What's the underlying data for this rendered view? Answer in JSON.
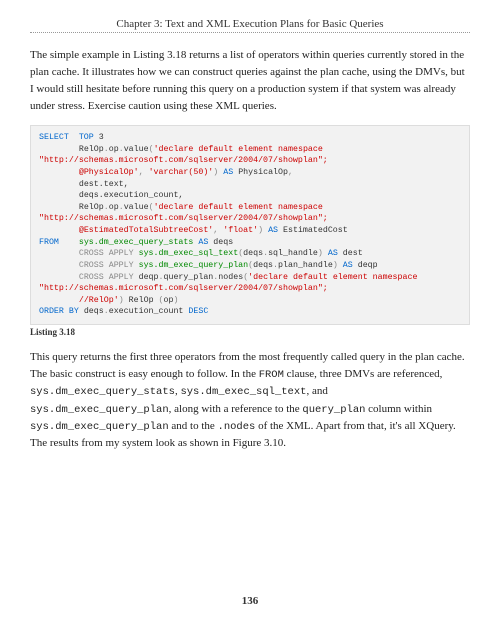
{
  "header": {
    "chapter_title": "Chapter 3: Text and XML Execution Plans for Basic Queries"
  },
  "para1": "The simple example in Listing 3.18 returns a list of operators within queries currently stored in the plan cache. It illustrates how we can construct queries against the plan cache, using the DMVs, but I would still hesitate before running this query on a production system if that system was already under stress. Exercise caution using these XML queries.",
  "code": {
    "l1a": "SELECT  TOP ",
    "l1b": "3",
    "l2a": "        RelOp",
    "l2b": ".",
    "l2c": "op",
    "l2d": ".",
    "l2e": "value",
    "l2f": "(",
    "l2g": "'declare default element namespace \"http://schemas.microsoft.com/sqlserver/2004/07/showplan\";",
    "l3a": "        @PhysicalOp'",
    "l3b": ", ",
    "l3c": "'varchar(50)'",
    "l3d": ")",
    "l3e": " AS ",
    "l3f": "PhysicalOp",
    "l3g": ",",
    "l4": "        dest.text,",
    "l5": "        deqs.execution_count,",
    "l6a": "        RelOp",
    "l6b": ".",
    "l6c": "op",
    "l6d": ".",
    "l6e": "value",
    "l6f": "(",
    "l6g": "'declare default element namespace \"http://schemas.microsoft.com/sqlserver/2004/07/showplan\";",
    "l7a": "        @EstimatedTotalSubtreeCost'",
    "l7b": ", ",
    "l7c": "'float'",
    "l7d": ")",
    "l7e": " AS ",
    "l7f": "EstimatedCost",
    "l8a": "FROM    ",
    "l8b": "sys.dm_exec_query_stats",
    "l8c": " AS ",
    "l8d": "deqs",
    "l9a": "        CROSS APPLY ",
    "l9b": "sys.dm_exec_sql_text",
    "l9c": "(",
    "l9d": "deqs",
    "l9e": ".",
    "l9f": "sql_handle",
    "l9g": ")",
    "l9h": " AS ",
    "l9i": "dest",
    "l10a": "        CROSS APPLY ",
    "l10b": "sys.dm_exec_query_plan",
    "l10c": "(",
    "l10d": "deqs",
    "l10e": ".",
    "l10f": "plan_handle",
    "l10g": ")",
    "l10h": " AS ",
    "l10i": "deqp",
    "l11a": "        CROSS APPLY ",
    "l11b": "deqp",
    "l11c": ".",
    "l11d": "query_plan",
    "l11e": ".",
    "l11f": "nodes",
    "l11g": "(",
    "l11h": "'declare default element namespace \"http://schemas.microsoft.com/sqlserver/2004/07/showplan\";",
    "l12a": "        //RelOp'",
    "l12b": ")",
    "l12c": " RelOp ",
    "l12d": "(",
    "l12e": "op",
    "l12f": ")",
    "l13a": "ORDER BY ",
    "l13b": "deqs",
    "l13c": ".",
    "l13d": "execution_count ",
    "l13e": "DESC"
  },
  "listing_label": "Listing 3.18",
  "para2_parts": {
    "p1": "This query returns the first three operators from the most frequently called query in the plan cache. The basic construct is easy enough to follow. In the ",
    "c1": "FROM",
    "p2": " clause, three DMVs are referenced, ",
    "c2": "sys.dm_exec_query_stats",
    "p3": ", ",
    "c3": "sys.dm_exec_sql_text",
    "p4": ", and ",
    "c4": "sys.dm_exec_query_plan",
    "p5": ", along with a reference to the ",
    "c5": "query_plan",
    "p6": " column within ",
    "c6": "sys.dm_exec_query_plan",
    "p7": " and to the ",
    "c7": ".nodes",
    "p8": " of the XML. Apart from that, it's all XQuery. The results from my system look as shown in Figure 3.10."
  },
  "page_number": "136"
}
